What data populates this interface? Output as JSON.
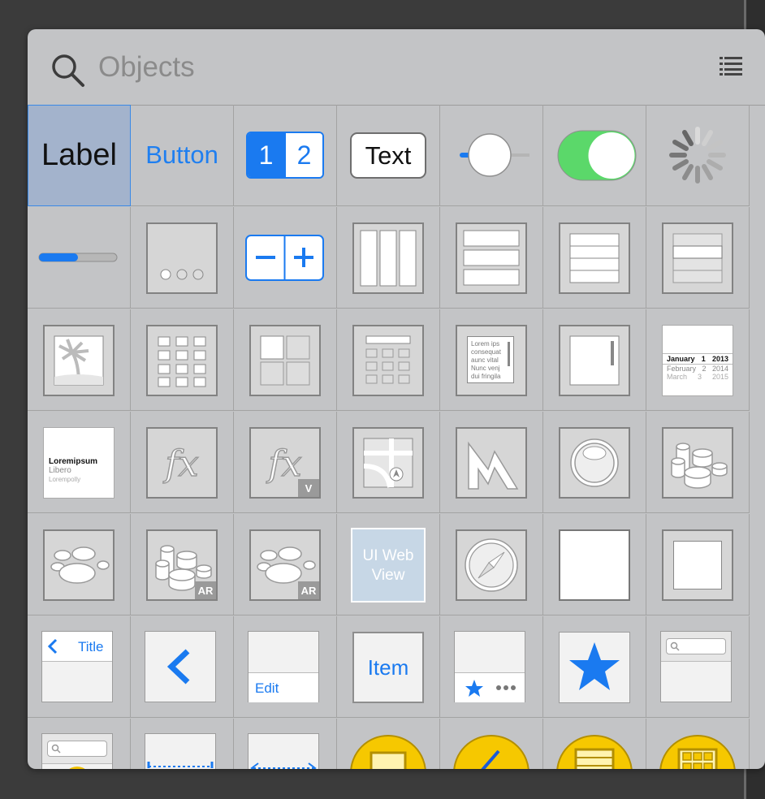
{
  "search": {
    "placeholder": "Objects"
  },
  "icons": {
    "search": "search-icon",
    "list_view": "list-view-icon"
  },
  "colors": {
    "accent": "#1f7ff0",
    "switch_on": "#5bd86a",
    "selection": "#a3b3cc",
    "panel": "#c3c4c6"
  },
  "objects": {
    "label": "Label",
    "button": "Button",
    "segmented": [
      "1",
      "2"
    ],
    "text_field": "Text",
    "web_view_line1": "UI Web",
    "web_view_line2": "View",
    "back_title": "Title",
    "edit": "Edit",
    "item": "Item",
    "badge_ar": "AR",
    "badge_v": "V",
    "text_view_lines": [
      "Lorem ips",
      "consequat",
      "aunc vital",
      "Nunc venj",
      "dui fringila"
    ],
    "date_picker": {
      "row1": [
        "January",
        "1",
        "2013"
      ],
      "row2": [
        "February",
        "2",
        "2014"
      ],
      "row3": [
        "March",
        "3",
        "2015"
      ]
    },
    "picker": {
      "title": "Loremipsum",
      "line2": "Libero",
      "line3": "Lorempolly"
    }
  },
  "progress": {
    "value": 0.5
  },
  "slider": {
    "value": 0.25
  },
  "switch": {
    "on": true
  }
}
